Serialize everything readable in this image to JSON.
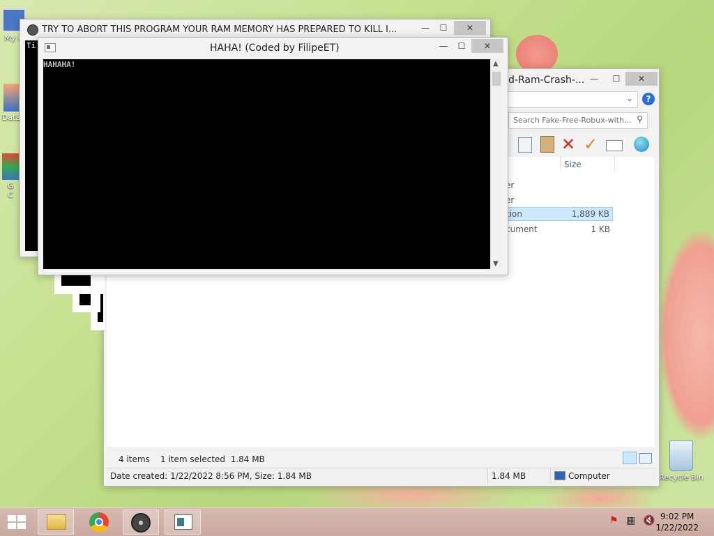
{
  "desktop": {
    "icons": [
      {
        "label": "My C"
      },
      {
        "label": "Data"
      },
      {
        "label": "G\nC"
      },
      {
        "label": "Recycle Bin"
      }
    ]
  },
  "explorer": {
    "title": "d-Ram-Crash-...",
    "search_placeholder": "Search Fake-Free-Robux-with...",
    "column_size": "Size",
    "rows": [
      {
        "type": "er",
        "size": ""
      },
      {
        "type": "er",
        "size": ""
      },
      {
        "type": "tion",
        "size": "1,889 KB"
      },
      {
        "type": "cument",
        "size": "1 KB"
      }
    ],
    "status_items": "4 items",
    "status_selected": "1 item selected  1.84 MB",
    "details": "Date created: 1/22/2022 8:56 PM, Size: 1.84 MB",
    "details_size": "1.84 MB",
    "details_location": "Computer"
  },
  "back_console": {
    "title": "TRY TO ABORT THIS PROGRAM YOUR RAM MEMORY HAS PREPARED TO KILL I...",
    "partial_text": "Ti"
  },
  "front_console": {
    "title": "HAHA! (Coded by FilipeET)",
    "text": "HAHAHA!"
  },
  "window_controls": {
    "minimize": "—",
    "maximize": "☐",
    "close": "✕"
  },
  "taskbar": {
    "clock_time": "9:02 PM",
    "clock_date": "1/22/2022"
  }
}
